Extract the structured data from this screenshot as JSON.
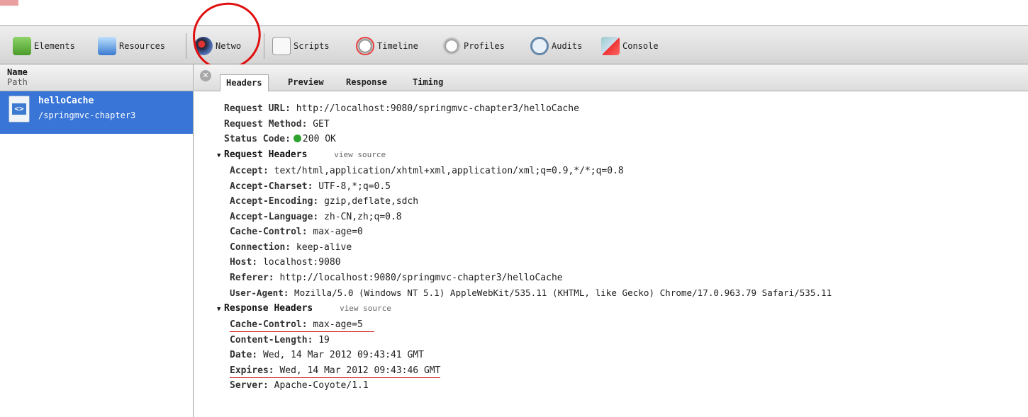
{
  "toolbar": {
    "items": [
      {
        "label": "Elements",
        "icon": "elements-icon"
      },
      {
        "label": "Resources",
        "icon": "resources-icon"
      },
      {
        "label": "Network",
        "icon": "network-icon",
        "annotated": true
      },
      {
        "label": "Scripts",
        "icon": "scripts-icon"
      },
      {
        "label": "Timeline",
        "icon": "timeline-icon"
      },
      {
        "label": "Profiles",
        "icon": "profiles-icon"
      },
      {
        "label": "Audits",
        "icon": "audits-icon"
      },
      {
        "label": "Console",
        "icon": "console-icon"
      }
    ],
    "network_label_visible": "Netwo"
  },
  "left_pane": {
    "column_name": "Name",
    "column_path": "Path",
    "request": {
      "name": "helloCache",
      "path": "/springmvc-chapter3"
    }
  },
  "tabs": [
    "Headers",
    "Preview",
    "Response",
    "Timing"
  ],
  "headers": {
    "request_url_key": "Request URL:",
    "request_url": "http://localhost:9080/springmvc-chapter3/helloCache",
    "request_method_key": "Request Method:",
    "request_method": "GET",
    "status_code_key": "Status Code:",
    "status_code": "200 OK",
    "request_headers_title": "Request Headers",
    "view_source": "view source",
    "request_headers": [
      {
        "k": "Accept:",
        "v": "text/html,application/xhtml+xml,application/xml;q=0.9,*/*;q=0.8"
      },
      {
        "k": "Accept-Charset:",
        "v": "UTF-8,*;q=0.5"
      },
      {
        "k": "Accept-Encoding:",
        "v": "gzip,deflate,sdch"
      },
      {
        "k": "Accept-Language:",
        "v": "zh-CN,zh;q=0.8"
      },
      {
        "k": "Cache-Control:",
        "v": "max-age=0"
      },
      {
        "k": "Connection:",
        "v": "keep-alive"
      },
      {
        "k": "Host:",
        "v": "localhost:9080"
      },
      {
        "k": "Referer:",
        "v": "http://localhost:9080/springmvc-chapter3/helloCache"
      },
      {
        "k": "User-Agent:",
        "v": "Mozilla/5.0 (Windows NT 5.1) AppleWebKit/535.11 (KHTML, like Gecko) Chrome/17.0.963.79 Safari/535.11"
      }
    ],
    "response_headers_title": "Response Headers",
    "response_headers": [
      {
        "k": "Cache-Control:",
        "v": "max-age=5",
        "underlined": true
      },
      {
        "k": "Content-Length:",
        "v": "19"
      },
      {
        "k": "Date:",
        "v": "Wed, 14 Mar 2012 09:43:41 GMT"
      },
      {
        "k": "Expires:",
        "v": "Wed, 14 Mar 2012 09:43:46 GMT",
        "underlined": true
      },
      {
        "k": "Server:",
        "v": "Apache-Coyote/1.1"
      }
    ]
  },
  "colors": {
    "selection": "#3875d7",
    "annotation": "#e01010",
    "status_ok": "#2fa32f"
  }
}
